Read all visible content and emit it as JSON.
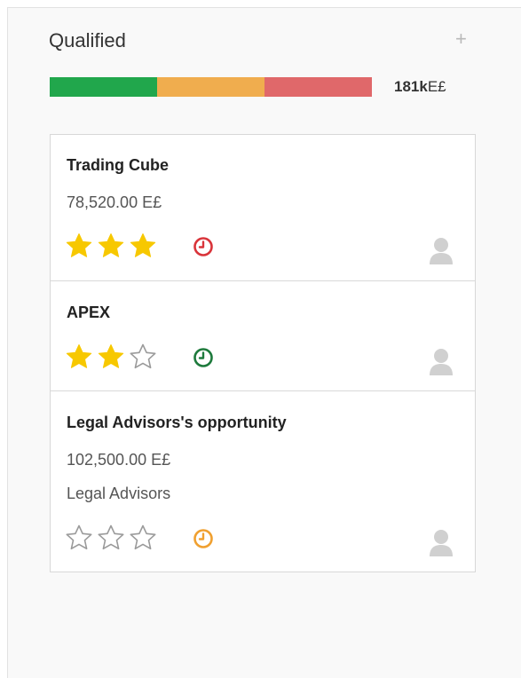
{
  "column": {
    "title": "Qualified",
    "add_icon": "plus-icon",
    "total_amount": "181k",
    "total_currency": "E£",
    "progress": [
      {
        "status": "on-track",
        "fraction": 0.333,
        "color": "#21a74c"
      },
      {
        "status": "near-deadline",
        "fraction": 0.334,
        "color": "#f0ad4e"
      },
      {
        "status": "overdue",
        "fraction": 0.333,
        "color": "#e0686a"
      }
    ]
  },
  "cards": [
    {
      "title": "Trading Cube",
      "amount": "78,520.00 E£",
      "company": "",
      "rating": 3,
      "max_rating": 3,
      "activity_icon": "clock-icon",
      "activity_color": "#d9343a",
      "avatar_icon": "user-avatar-icon"
    },
    {
      "title": "APEX",
      "amount": "",
      "company": "",
      "rating": 2,
      "max_rating": 3,
      "activity_icon": "clock-icon",
      "activity_color": "#1e7a3c",
      "avatar_icon": "user-avatar-icon"
    },
    {
      "title": "Legal Advisors's opportunity",
      "amount": "102,500.00 E£",
      "company": "Legal Advisors",
      "rating": 0,
      "max_rating": 3,
      "activity_icon": "clock-icon",
      "activity_color": "#f0a030",
      "avatar_icon": "user-avatar-icon"
    }
  ],
  "colors": {
    "star_filled": "#f7c800",
    "star_empty": "#9a9a9a",
    "avatar": "#d0d0d0"
  }
}
